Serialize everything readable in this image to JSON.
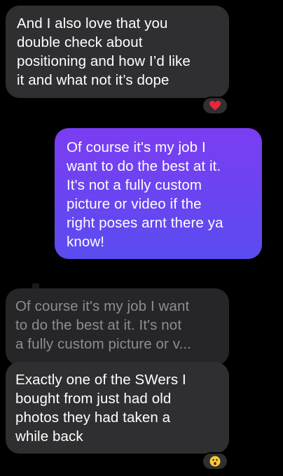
{
  "messages": [
    {
      "direction": "incoming",
      "lines": [
        "And I also love that you",
        "double check about",
        "positioning and how I’d like",
        "it and what not it’s dope"
      ],
      "reaction": "red-heart"
    },
    {
      "direction": "outgoing",
      "lines": [
        "Of course it's my job I",
        "want to do the best at it.",
        "It's not a fully custom",
        "picture or video if the",
        "right poses arnt there ya",
        "know!"
      ]
    },
    {
      "direction": "quoted-reply",
      "lines": [
        "Of course it's my job I want",
        "to do the best at it. It's not",
        "a fully custom picture or v..."
      ]
    },
    {
      "direction": "incoming",
      "lines": [
        "Exactly one of the SWers I",
        "bought from just had old",
        "photos they had taken a",
        "while back"
      ],
      "reaction": "astonished-face"
    }
  ],
  "colors": {
    "background": "#000000",
    "incoming_bubble": "#2f2f31",
    "outgoing_gradient_start": "#7b3df2",
    "outgoing_gradient_end": "#5a4cf0",
    "quoted_text": "#8d8d90",
    "heart": "#e8263a",
    "emoji_face": "#ffcc33"
  }
}
